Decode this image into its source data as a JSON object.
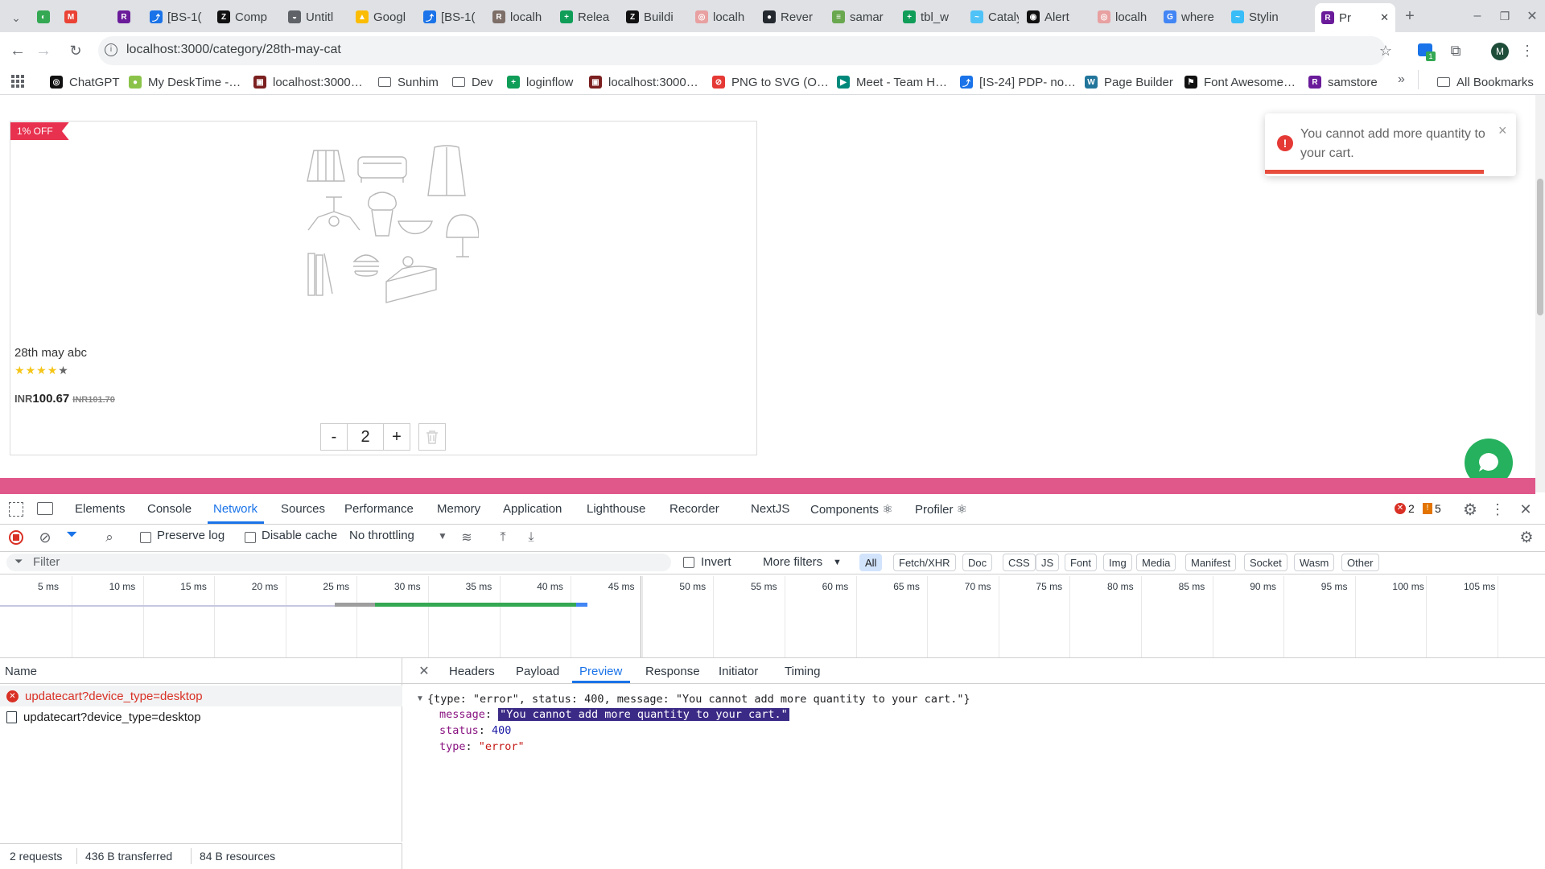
{
  "browser": {
    "tabs": [
      {
        "label": "",
        "color": "#34a853",
        "glyph": "◐"
      },
      {
        "label": "",
        "color": "#ea4335",
        "glyph": "M"
      },
      {
        "label": "",
        "color": "#6a1b9a",
        "glyph": "R"
      },
      {
        "label": "[BS-1(",
        "color": "#1a73e8",
        "glyph": "⤴"
      },
      {
        "label": "Comp",
        "color": "#111111",
        "glyph": "Z"
      },
      {
        "label": "Untitl",
        "color": "#5f6368",
        "glyph": "◒"
      },
      {
        "label": "Googl",
        "color": "#fbbc04",
        "glyph": "▲"
      },
      {
        "label": "[BS-1(",
        "color": "#1a73e8",
        "glyph": "⤴"
      },
      {
        "label": "localh",
        "color": "#7d6e67",
        "glyph": "R"
      },
      {
        "label": "Relea",
        "color": "#0f9d58",
        "glyph": "+"
      },
      {
        "label": "Buildi",
        "color": "#111111",
        "glyph": "Z"
      },
      {
        "label": "localh",
        "color": "#e8a0a0",
        "glyph": "◎"
      },
      {
        "label": "Rever",
        "color": "#24292f",
        "glyph": "●"
      },
      {
        "label": "samar",
        "color": "#6aa84f",
        "glyph": "≡"
      },
      {
        "label": "tbl_w",
        "color": "#0f9d58",
        "glyph": "+"
      },
      {
        "label": "Cataly",
        "color": "#4fc3f7",
        "glyph": "~"
      },
      {
        "label": "Alert",
        "color": "#111111",
        "glyph": "◉"
      },
      {
        "label": "localh",
        "color": "#e8a0a0",
        "glyph": "◎"
      },
      {
        "label": "where",
        "color": "#4285f4",
        "glyph": "G"
      },
      {
        "label": "Stylin",
        "color": "#38bdf8",
        "glyph": "~"
      },
      {
        "label": "Pr",
        "color": "#6a1b9a",
        "glyph": "R"
      }
    ],
    "url": "localhost:3000/category/28th-may-cat",
    "profile_initial": "M",
    "extension_badge": "1",
    "bookmarks": [
      {
        "label": "ChatGPT",
        "color": "#111111",
        "glyph": "◎"
      },
      {
        "label": "My DeskTime -…",
        "color": "#8bc34a",
        "glyph": "●"
      },
      {
        "label": "localhost:3000…",
        "color": "#7b1f1f",
        "glyph": "▣"
      },
      {
        "label": "Sunhim",
        "color": "",
        "glyph": "folder"
      },
      {
        "label": "Dev",
        "color": "",
        "glyph": "folder"
      },
      {
        "label": "loginflow",
        "color": "#0f9d58",
        "glyph": "+"
      },
      {
        "label": "localhost:3000…",
        "color": "#7b1f1f",
        "glyph": "▣"
      },
      {
        "label": "PNG to SVG (O…",
        "color": "#e53935",
        "glyph": "⊘"
      },
      {
        "label": "Meet - Team H…",
        "color": "#00897b",
        "glyph": "▶"
      },
      {
        "label": "[IS-24] PDP- no…",
        "color": "#1a73e8",
        "glyph": "⤴"
      },
      {
        "label": "Page Builder",
        "color": "#21759b",
        "glyph": "W"
      },
      {
        "label": "Font Awesome…",
        "color": "#111111",
        "glyph": "⚑"
      },
      {
        "label": "samstore",
        "color": "#6a1b9a",
        "glyph": "R"
      }
    ],
    "all_bookmarks_label": "All Bookmarks"
  },
  "product": {
    "badge": "1% OFF",
    "name": "28th may abc",
    "rating": 4,
    "rating_max": 5,
    "currency": "INR",
    "price": "100.67",
    "old_price": "INR101.70",
    "quantity": "2",
    "minus": "-",
    "plus": "+"
  },
  "toast": {
    "message": "You cannot add more quantity to your cart.",
    "close": "×"
  },
  "devtools": {
    "tabs": [
      "Elements",
      "Console",
      "Network",
      "Sources",
      "Performance",
      "Memory",
      "Application",
      "Lighthouse",
      "Recorder",
      "NextJS",
      "Components ⚛",
      "Profiler ⚛"
    ],
    "active_tab": "Network",
    "error_count": "2",
    "warning_count": "5",
    "preserve_log": "Preserve log",
    "disable_cache": "Disable cache",
    "throttling": "No throttling",
    "filter_placeholder": "Filter",
    "invert": "Invert",
    "more_filters": "More filters",
    "type_filters": [
      "All",
      "Fetch/XHR",
      "Doc",
      "CSS",
      "JS",
      "Font",
      "Img",
      "Media",
      "Manifest",
      "Socket",
      "Wasm",
      "Other"
    ],
    "timeline_ticks": [
      "5 ms",
      "10 ms",
      "15 ms",
      "20 ms",
      "25 ms",
      "30 ms",
      "35 ms",
      "40 ms",
      "45 ms",
      "50 ms",
      "55 ms",
      "60 ms",
      "65 ms",
      "70 ms",
      "75 ms",
      "80 ms",
      "85 ms",
      "90 ms",
      "95 ms",
      "100 ms",
      "105 ms",
      "1"
    ],
    "name_header": "Name",
    "requests": [
      {
        "name": "updatecart?device_type=desktop",
        "error": true
      },
      {
        "name": "updatecart?device_type=desktop",
        "error": false
      }
    ],
    "status": {
      "requests": "2 requests",
      "transferred": "436 B transferred",
      "resources": "84 B resources"
    },
    "detail_tabs": [
      "Headers",
      "Payload",
      "Preview",
      "Response",
      "Initiator",
      "Timing"
    ],
    "active_detail_tab": "Preview",
    "preview": {
      "summary": "{type: \"error\", status: 400, message: \"You cannot add more quantity to your cart.\"}",
      "message_key": "message",
      "message_value": "\"You cannot add more quantity to your cart.\"",
      "status_key": "status",
      "status_value": "400",
      "type_key": "type",
      "type_value": "\"error\""
    }
  }
}
